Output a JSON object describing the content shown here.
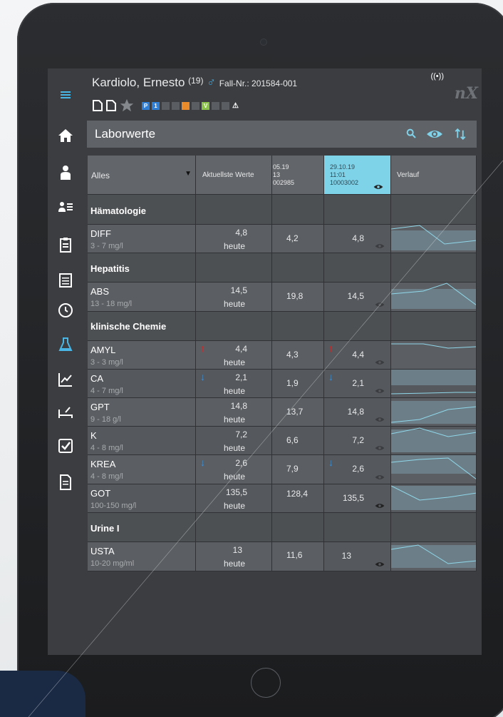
{
  "patient": {
    "name": "Kardiolo, Ernesto",
    "age": "(19)",
    "sex_symbol": "♂",
    "case_label": "Fall-Nr.: 201584-001"
  },
  "header": {
    "wifi_symbol": "((•))",
    "logo": "nX",
    "badges": [
      "P",
      "1",
      "",
      "",
      "",
      "V",
      "",
      "",
      "⚠"
    ]
  },
  "titlebar": {
    "title": "Laborwerte"
  },
  "table": {
    "filter_label": "Alles",
    "col_latest": "Aktuellste Werte",
    "col_prev": {
      "date": "05.19",
      "time": "13",
      "id": "002985"
    },
    "col_sel": {
      "date": "29.10.19",
      "time": "11:01",
      "id": "10003002"
    },
    "col_trend": "Verlauf"
  },
  "groups": {
    "hematology": "Hämatologie",
    "hepatitis": "Hepatitis",
    "chem": "klinische Chemie",
    "urine": "Urine I"
  },
  "rows": {
    "diff": {
      "name": "DIFF",
      "range": "3 - 7 mg/l",
      "latest": "4,8",
      "when": "heute",
      "prev": "4,2",
      "sel": "4,8"
    },
    "abs": {
      "name": "ABS",
      "range": "13 - 18 mg/l",
      "latest": "14,5",
      "when": "heute",
      "prev": "19,8",
      "sel": "14,5"
    },
    "amyl": {
      "name": "AMYL",
      "range": "3 - 3 mg/l",
      "latest": "4,4",
      "when": "heute",
      "prev": "4,3",
      "sel": "4,4"
    },
    "ca": {
      "name": "CA",
      "range": "4 - 7 mg/l",
      "latest": "2,1",
      "when": "heute",
      "prev": "1,9",
      "sel": "2,1"
    },
    "gpt": {
      "name": "GPT",
      "range": "9 - 18 g/l",
      "latest": "14,8",
      "when": "heute",
      "prev": "13,7",
      "sel": "14,8"
    },
    "k": {
      "name": "K",
      "range": "4 - 8 mg/l",
      "latest": "7,2",
      "when": "heute",
      "prev": "6,6",
      "sel": "7,2"
    },
    "krea": {
      "name": "KREA",
      "range": "4 - 8 mg/l",
      "latest": "2,6",
      "when": "heute",
      "prev": "7,9",
      "sel": "2,6"
    },
    "got": {
      "name": "GOT",
      "range": "100-150 mg/l",
      "latest": "135,5",
      "when": "heute",
      "prev": "128,4",
      "sel": "135,5"
    },
    "usta": {
      "name": "USTA",
      "range": "10-20 mg/ml",
      "latest": "13",
      "when": "heute",
      "prev": "11,6",
      "sel": "13"
    }
  },
  "colors": {
    "accent": "#7fd3e8",
    "high": "#e02020",
    "low": "#3a8fd9"
  }
}
